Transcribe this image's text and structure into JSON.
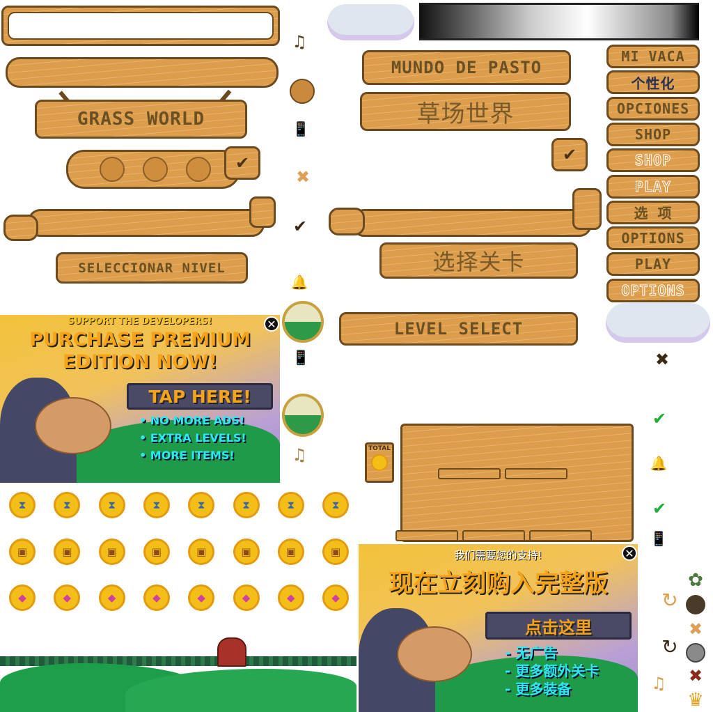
{
  "signs": {
    "grass_world": "GRASS WORLD",
    "seleccionar_nivel": "SELECCIONAR NIVEL",
    "mundo_de_pasto": "MUNDO DE PASTO",
    "caochang_shijie": "草场世界",
    "xuanze_guanka": "选择关卡",
    "level_select": "LEVEL SELECT"
  },
  "buttons": [
    {
      "label": "MI VACA",
      "style": "dark"
    },
    {
      "label": "个性化",
      "style": "navy"
    },
    {
      "label": "OPCIONES",
      "style": "dark"
    },
    {
      "label": "SHOP",
      "style": "dark"
    },
    {
      "label": "SHOP",
      "style": "outline"
    },
    {
      "label": "PLAY",
      "style": "outline"
    },
    {
      "label": "选 项",
      "style": "dark"
    },
    {
      "label": "OPTIONS",
      "style": "dark"
    },
    {
      "label": "PLAY",
      "style": "dark"
    },
    {
      "label": "OPTIONS",
      "style": "outline"
    }
  ],
  "total_panel": {
    "label": "TOTAL"
  },
  "ad_en": {
    "support": "SUPPORT THE DEVELOPERS!",
    "headline1": "PURCHASE PREMIUM",
    "headline2": "EDITION NOW!",
    "tap": "TAP HERE!",
    "bullets": [
      "• NO MORE ADS!",
      "• EXTRA LEVELS!",
      "• MORE ITEMS!"
    ]
  },
  "ad_cn": {
    "support": "我们需要您的支持!",
    "headline": "现在立刻购入完整版",
    "tap": "点击这里",
    "bullets": [
      "- 无广告",
      "- 更多额外关卡",
      "- 更多装备"
    ]
  },
  "icons": {
    "close": "✕",
    "check": "✔",
    "cross": "✖",
    "note": "♫",
    "bell": "🔔",
    "phone": "📱",
    "refresh": "↻",
    "crown": "♛",
    "hourglass": "⧗",
    "chest": "▣",
    "gem": "◆"
  },
  "colors": {
    "wood": "#dc9d4c",
    "wood_border": "#6b4a1f",
    "text_dark": "#6a5022",
    "coin": "#f4be18",
    "ad_orange": "#f7a31a",
    "ad_cyan": "#2ee8f0",
    "check_green": "#1fae3a"
  }
}
